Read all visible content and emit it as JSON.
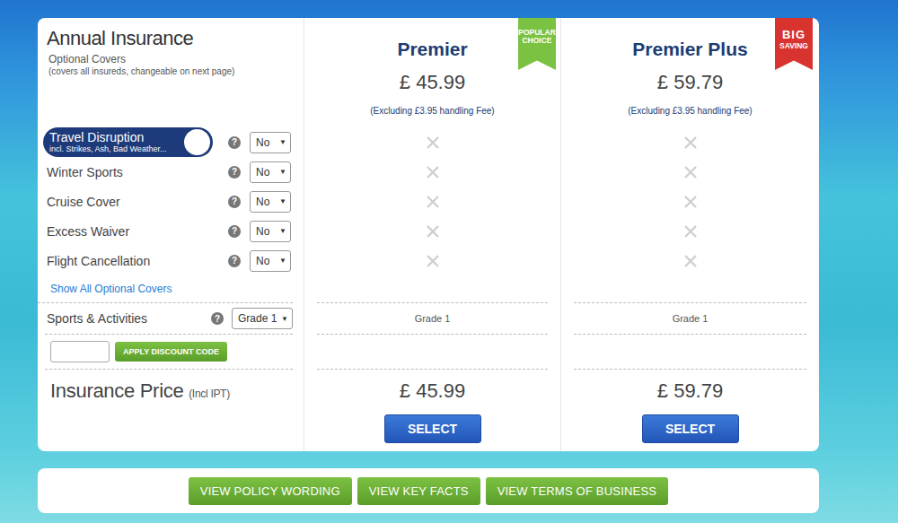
{
  "header": {
    "title": "Annual Insurance",
    "subtitle": "Optional Covers",
    "note": "(covers all insureds, changeable on next page)"
  },
  "dropdown_arrow": "▼",
  "help_glyph": "?",
  "plans": [
    {
      "name": "Premier",
      "price": "£ 45.99",
      "fee_note": "(Excluding £3.95 handling Fee)",
      "badge": {
        "kind": "popular",
        "lines": [
          "POPULAR",
          "CHOICE"
        ],
        "color": "#7cc242"
      },
      "included": [
        false,
        false,
        false,
        false,
        false
      ],
      "activities": "Grade 1",
      "total": "£ 45.99",
      "select": "SELECT"
    },
    {
      "name": "Premier Plus",
      "price": "£ 59.79",
      "fee_note": "(Excluding £3.95 handling Fee)",
      "badge": {
        "kind": "saving",
        "lines": [
          "BIG",
          "SAVING"
        ],
        "color": "#d8332f"
      },
      "included": [
        false,
        false,
        false,
        false,
        false
      ],
      "activities": "Grade 1",
      "total": "£ 59.79",
      "select": "SELECT"
    }
  ],
  "covers": [
    {
      "label": "Travel Disruption",
      "detail": "incl. Strikes, Ash, Bad Weather...",
      "highlighted": true,
      "value": "No"
    },
    {
      "label": "Winter Sports",
      "detail": "",
      "highlighted": false,
      "value": "No"
    },
    {
      "label": "Cruise Cover",
      "detail": "",
      "highlighted": false,
      "value": "No"
    },
    {
      "label": "Excess Waiver",
      "detail": "",
      "highlighted": false,
      "value": "No"
    },
    {
      "label": "Flight Cancellation",
      "detail": "",
      "highlighted": false,
      "value": "No"
    }
  ],
  "show_all": "Show All Optional Covers",
  "activities": {
    "label": "Sports & Activities",
    "value": "Grade 1"
  },
  "discount": {
    "button": "APPLY DISCOUNT CODE"
  },
  "price_row": {
    "label": "Insurance Price",
    "suffix": "(Incl IPT)"
  },
  "footer_buttons": [
    "VIEW POLICY WORDING",
    "VIEW KEY FACTS",
    "VIEW TERMS OF BUSINESS"
  ]
}
